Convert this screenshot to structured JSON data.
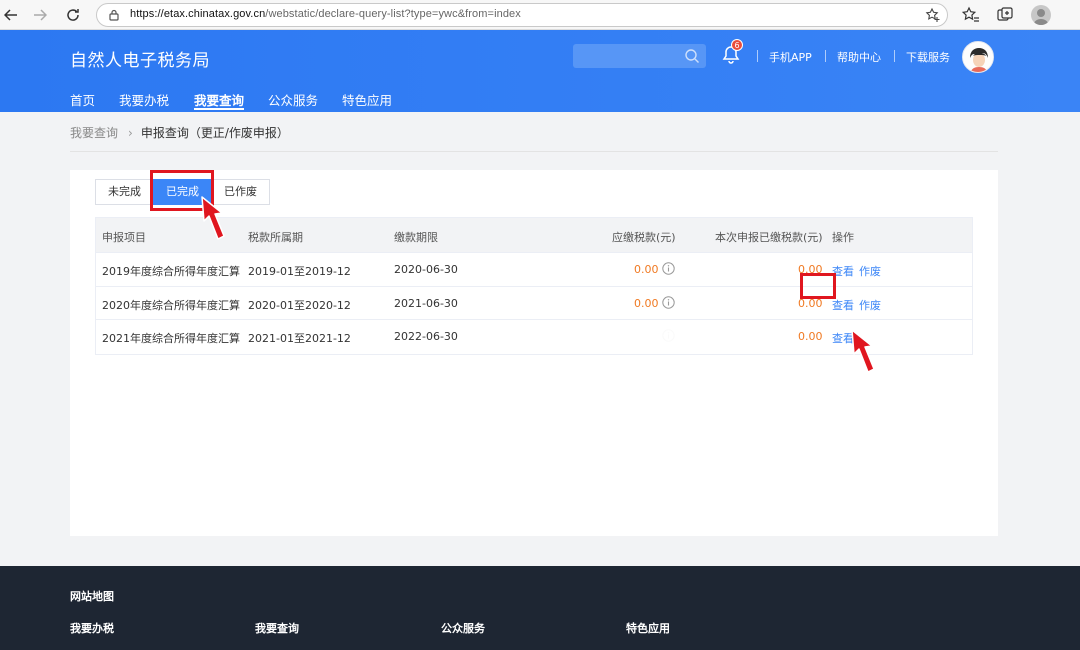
{
  "browser": {
    "url_host": "https://etax.chinatax.gov.cn",
    "url_path": "/webstatic/declare-query-list?type=ywc&from=index"
  },
  "header": {
    "site_title": "自然人电子税务局",
    "search_placeholder": "",
    "notification_count": "6",
    "links": [
      "手机APP",
      "帮助中心",
      "下载服务"
    ]
  },
  "nav": {
    "items": [
      "首页",
      "我要办税",
      "我要查询",
      "公众服务",
      "特色应用"
    ],
    "active_index": 2
  },
  "breadcrumb": {
    "parent": "我要查询",
    "current": "申报查询（更正/作废申报）"
  },
  "tabs": [
    "未完成",
    "已完成",
    "已作废"
  ],
  "active_tab": 1,
  "table": {
    "headers": [
      "申报项目",
      "税款所属期",
      "缴款期限",
      "应缴税款(元)",
      "本次申报已缴税款(元)",
      "操作"
    ],
    "rows": [
      {
        "item": "2019年度综合所得年度汇算",
        "period": "2019-01至2019-12",
        "deadline": "2020-06-30",
        "tax_due": "0.00",
        "tax_paid": "0.00",
        "ops": [
          "查看",
          "作废"
        ]
      },
      {
        "item": "2020年度综合所得年度汇算",
        "period": "2020-01至2020-12",
        "deadline": "2021-06-30",
        "tax_due": "0.00",
        "tax_paid": "0.00",
        "ops": [
          "查看",
          "作废"
        ]
      },
      {
        "item": "2021年度综合所得年度汇算",
        "period": "2021-01至2021-12",
        "deadline": "2022-06-30",
        "tax_due": "",
        "tax_paid": "0.00",
        "ops": [
          "查看"
        ]
      }
    ]
  },
  "footer": {
    "title": "网站地图",
    "columns": [
      "我要办税",
      "我要查询",
      "公众服务",
      "特色应用"
    ]
  },
  "colors": {
    "brand_blue": "#2f7cf5",
    "amount_orange": "#f07a23",
    "link_blue": "#3b86f7",
    "highlight_red": "#e0161f",
    "footer_bg": "#1e2633"
  }
}
